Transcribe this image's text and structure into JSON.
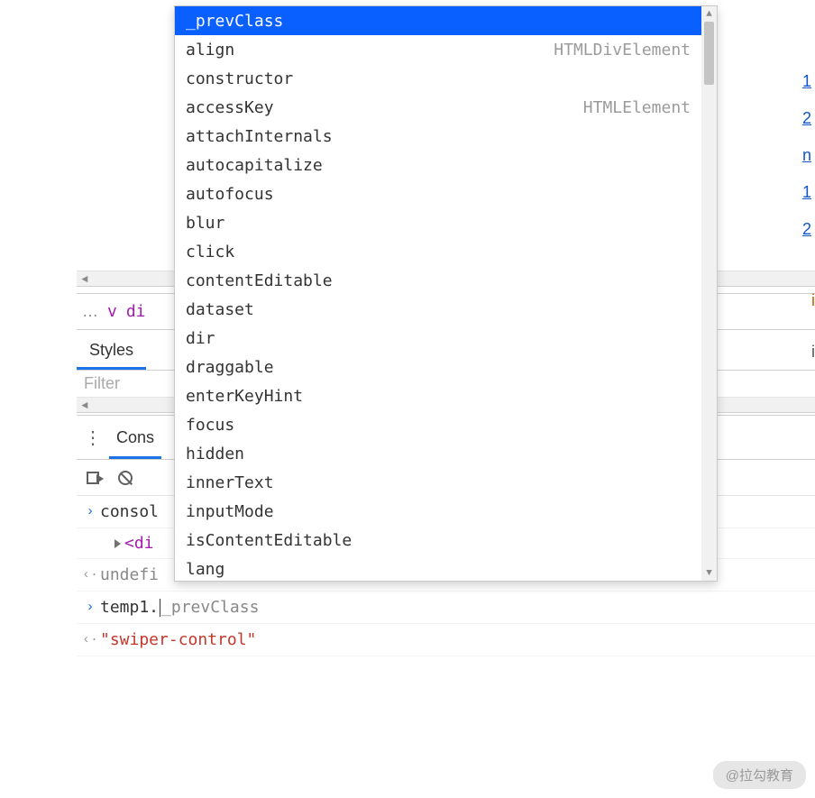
{
  "autocomplete": {
    "selectedIndex": 0,
    "items": [
      {
        "label": "_prevClass",
        "hint": ""
      },
      {
        "label": "align",
        "hint": "HTMLDivElement"
      },
      {
        "label": "constructor",
        "hint": ""
      },
      {
        "label": "accessKey",
        "hint": "HTMLElement"
      },
      {
        "label": "attachInternals",
        "hint": ""
      },
      {
        "label": "autocapitalize",
        "hint": ""
      },
      {
        "label": "autofocus",
        "hint": ""
      },
      {
        "label": "blur",
        "hint": ""
      },
      {
        "label": "click",
        "hint": ""
      },
      {
        "label": "contentEditable",
        "hint": ""
      },
      {
        "label": "dataset",
        "hint": ""
      },
      {
        "label": "dir",
        "hint": ""
      },
      {
        "label": "draggable",
        "hint": ""
      },
      {
        "label": "enterKeyHint",
        "hint": ""
      },
      {
        "label": "focus",
        "hint": ""
      },
      {
        "label": "hidden",
        "hint": ""
      },
      {
        "label": "innerText",
        "hint": ""
      },
      {
        "label": "inputMode",
        "hint": ""
      },
      {
        "label": "isContentEditable",
        "hint": ""
      },
      {
        "label": "lang",
        "hint": ""
      }
    ]
  },
  "breadcrumb": {
    "dots": "…",
    "v": "v",
    "div": "di"
  },
  "tabs": {
    "styles": "Styles"
  },
  "filterPlaceholder": "Filter",
  "drawer": {
    "console": "Cons"
  },
  "sideLinks": [
    "1",
    "2",
    "n",
    "1",
    "2"
  ],
  "sideTab": "i",
  "console": {
    "line1": "consol",
    "elText": "<di",
    "undef": "undefi",
    "promptVar": "temp1.",
    "promptGhost": "_prevClass",
    "resultStr": "\"swiper-control\""
  },
  "watermark": "@拉勾教育"
}
